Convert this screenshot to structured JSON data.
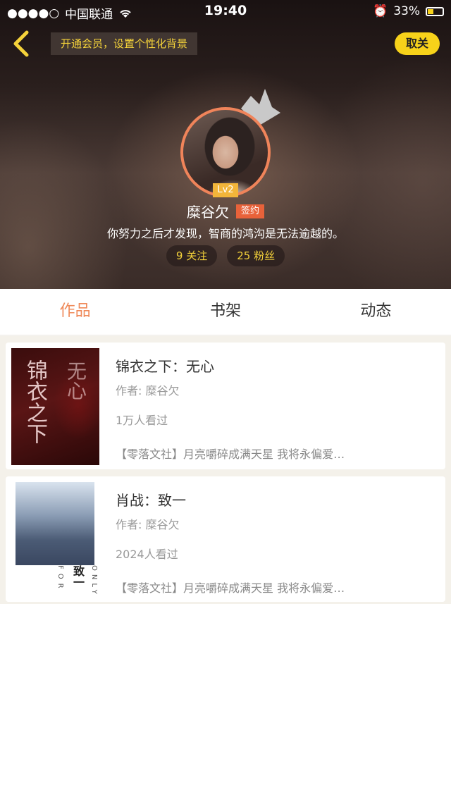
{
  "status_bar": {
    "carrier": "中国联通",
    "time": "19:40",
    "battery": "33%"
  },
  "header": {
    "vip_banner": "开通会员，设置个性化背景",
    "follow_button": "取关",
    "level": "Lv2",
    "username": "糜谷欠",
    "signed_badge": "签约",
    "bio": "你努力之后才发现，智商的鸿沟是无法逾越的。",
    "following": "9 关注",
    "followers": "25 粉丝"
  },
  "tabs": [
    {
      "label": "作品",
      "active": true
    },
    {
      "label": "书架",
      "active": false
    },
    {
      "label": "动态",
      "active": false
    }
  ],
  "works": [
    {
      "title": "锦衣之下：无心",
      "author": "作者: 糜谷欠",
      "views": "1万人看过",
      "description": "【零落文社】月亮嚼碎成满天星 我将永偏爱…"
    },
    {
      "title": "肖战：致一",
      "author": "作者: 糜谷欠",
      "views": "2024人看过",
      "description": "【零落文社】月亮嚼碎成满天星 我将永偏爱…"
    }
  ],
  "colors": {
    "accent_yellow": "#f7d21a",
    "accent_orange": "#ef8a5a",
    "badge_red": "#e8623a"
  }
}
